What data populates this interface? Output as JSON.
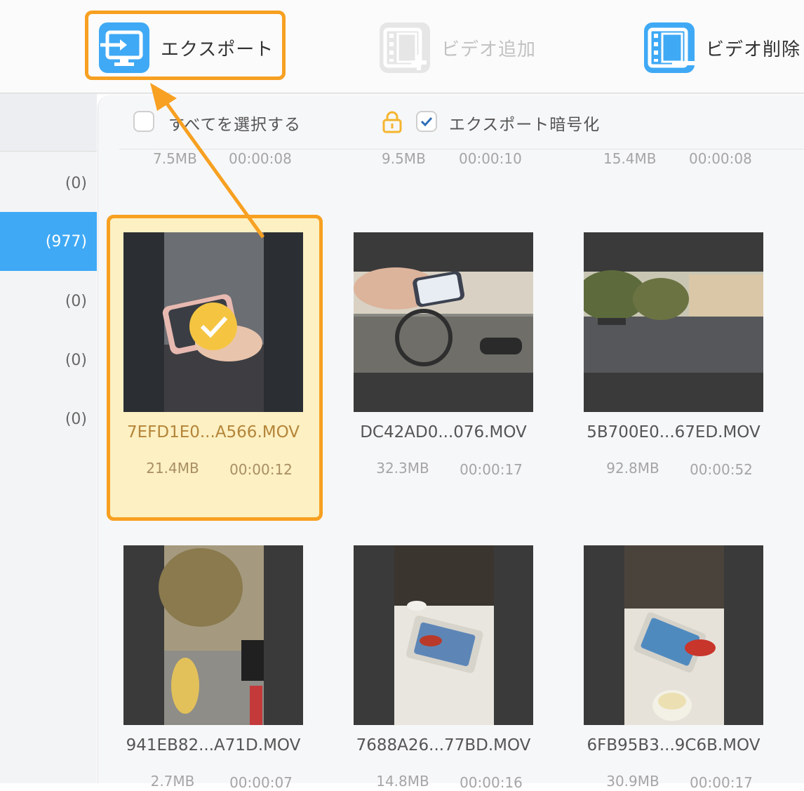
{
  "toolbar": {
    "export_label": "エクスポート",
    "add_video_label": "ビデオ追加",
    "delete_video_label": "ビデオ削除"
  },
  "sidebar": {
    "items": [
      {
        "count": "(0)",
        "active": false
      },
      {
        "count": "(977)",
        "active": true
      },
      {
        "count": "(0)",
        "active": false
      },
      {
        "count": "(0)",
        "active": false
      },
      {
        "count": "(0)",
        "active": false
      }
    ]
  },
  "options": {
    "select_all_label": "すべてを選択する",
    "encrypt_label": "エクスポート暗号化",
    "encrypt_checked": true
  },
  "prev_row": [
    {
      "size": "7.5MB",
      "duration": "00:00:08"
    },
    {
      "size": "9.5MB",
      "duration": "00:00:10"
    },
    {
      "size": "15.4MB",
      "duration": "00:00:08"
    }
  ],
  "videos": [
    {
      "name": "7EFD1E0...A566.MOV",
      "size": "21.4MB",
      "duration": "00:00:12",
      "selected": true
    },
    {
      "name": "DC42AD0...076.MOV",
      "size": "32.3MB",
      "duration": "00:00:17",
      "selected": false
    },
    {
      "name": "5B700E0...67ED.MOV",
      "size": "92.8MB",
      "duration": "00:00:52",
      "selected": false
    },
    {
      "name": "941EB82...A71D.MOV",
      "size": "2.7MB",
      "duration": "00:00:07",
      "selected": false
    },
    {
      "name": "7688A26...77BD.MOV",
      "size": "14.8MB",
      "duration": "00:00:16",
      "selected": false
    },
    {
      "name": "6FB95B3...9C6B.MOV",
      "size": "30.9MB",
      "duration": "00:00:17",
      "selected": false
    }
  ],
  "colors": {
    "accent_blue": "#3fa9f5",
    "highlight_orange": "#f7a021",
    "selected_bg": "#fdf0c2",
    "check_yellow": "#f5c542"
  },
  "icons": {
    "export": "export-icon",
    "add_video": "film-add-icon",
    "delete_video": "film-delete-icon",
    "lock": "lock-icon",
    "check": "checkmark-icon"
  }
}
